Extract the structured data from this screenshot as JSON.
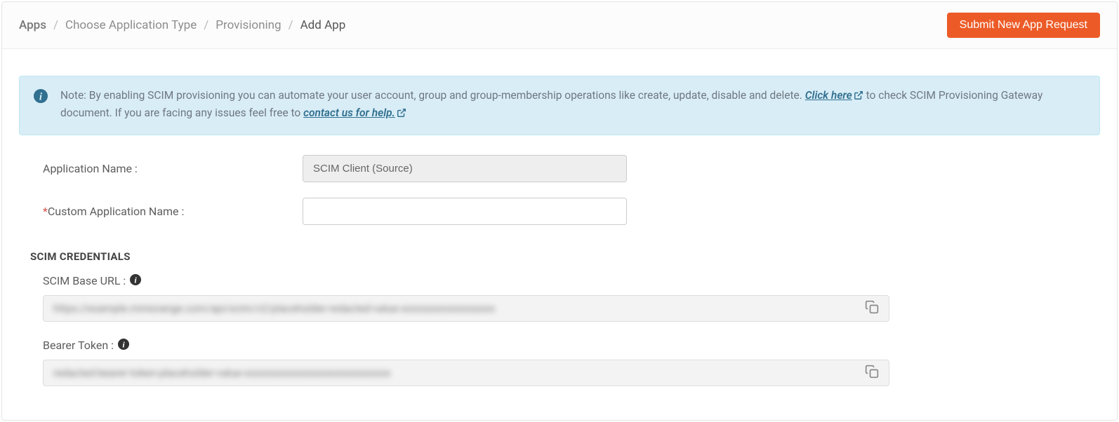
{
  "breadcrumb": {
    "items": [
      "Apps",
      "Choose Application Type",
      "Provisioning",
      "Add App"
    ]
  },
  "header": {
    "submit_label": "Submit New App Request"
  },
  "banner": {
    "text_before_link1": "Note: By enabling SCIM provisioning you can automate your user account, group and group-membership operations like create, update, disable and delete. ",
    "link1": "Click here",
    "text_mid": " to check SCIM Provisioning Gateway document. If you are facing any issues feel free to ",
    "link2": "contact us for help.",
    "text_after": ""
  },
  "form": {
    "app_name_label": "Application Name :",
    "app_name_value": "SCIM Client (Source)",
    "custom_name_label": "Custom Application Name :",
    "custom_name_value": ""
  },
  "section": {
    "title": "SCIM CREDENTIALS",
    "base_url_label": "SCIM Base URL :",
    "base_url_value": "https://example.miniorange.com/api/scim/v2/placeholder-redacted-value-xxxxxxxxxxxxxxxxxx",
    "token_label": "Bearer Token :",
    "token_value": "redacted-bearer-token-placeholder-value-xxxxxxxxxxxxxxxxxxxxxxxxxxxx"
  }
}
